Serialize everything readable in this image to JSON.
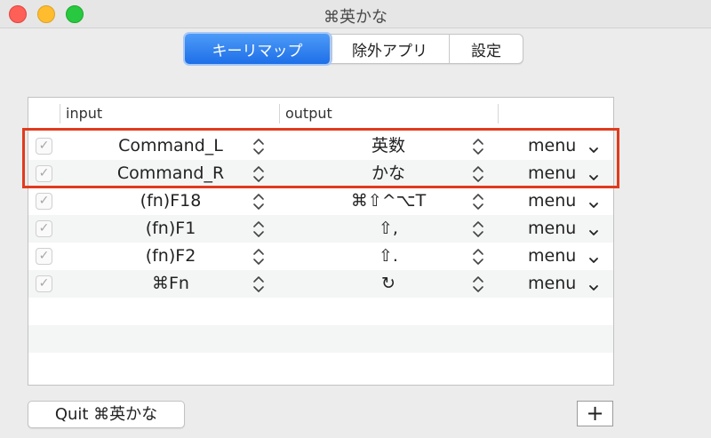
{
  "window": {
    "title": "⌘英かな"
  },
  "tabs": [
    {
      "label": "キーリマップ",
      "active": true
    },
    {
      "label": "除外アプリ",
      "active": false
    },
    {
      "label": "設定",
      "active": false
    }
  ],
  "table": {
    "columns": [
      "input",
      "output"
    ],
    "rows": [
      {
        "checked": true,
        "input": "Command_L",
        "output": "英数",
        "action": "menu"
      },
      {
        "checked": true,
        "input": "Command_R",
        "output": "かな",
        "action": "menu"
      },
      {
        "checked": true,
        "input": "(fn)F18",
        "output": "⌘⇧^⌥T",
        "action": "menu"
      },
      {
        "checked": true,
        "input": "(fn)F1",
        "output": "⇧,",
        "action": "menu"
      },
      {
        "checked": true,
        "input": "(fn)F2",
        "output": "⇧.",
        "action": "menu"
      },
      {
        "checked": true,
        "input": "⌘Fn",
        "output": "↻",
        "action": "menu"
      }
    ]
  },
  "footer": {
    "quit_label": "Quit ⌘英かな",
    "add_label": "+"
  },
  "icons": {
    "checkmark": "checkmark-icon",
    "stepper": "up-down-chevron-icon",
    "dropdown": "chevron-down-icon",
    "traffic_lights": [
      "close-icon",
      "minimize-icon",
      "zoom-icon"
    ]
  },
  "colors": {
    "accent": "#1e6fe8",
    "highlight_box": "#e03b1d",
    "close": "#fe5f57",
    "minimize": "#febc2e",
    "zoom": "#28c840"
  }
}
